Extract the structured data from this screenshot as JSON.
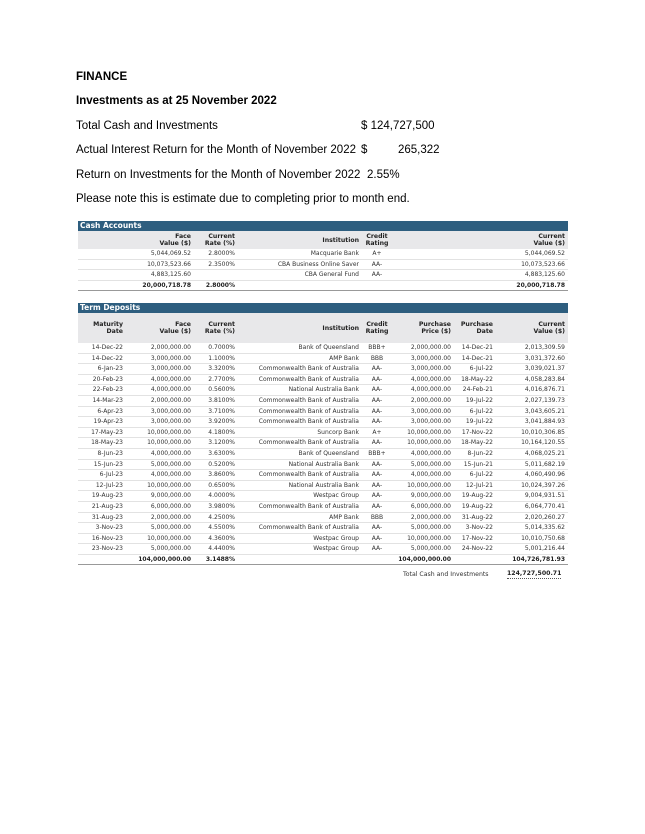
{
  "heading": "FINANCE",
  "subheading": "Investments as at 25 November 2022",
  "summary": [
    {
      "label": "Total Cash and Investments",
      "value": "$ 124,727,500"
    },
    {
      "label": "Actual Interest Return for the Month of November 2022",
      "currency": "$",
      "value": "265,322"
    },
    {
      "label": "Return on Investments for the Month of November 2022",
      "value": "2.55%"
    }
  ],
  "note": "Please note this is estimate due to completing prior to month end.",
  "cash_accounts": {
    "title": "Cash Accounts",
    "headers": {
      "face_value": [
        "Face",
        "Value ($)"
      ],
      "current_rate": [
        "Current",
        "Rate (%)"
      ],
      "institution": "Institution",
      "credit_rating": [
        "Credit",
        "Rating"
      ],
      "current_value": [
        "Current",
        "Value ($)"
      ]
    },
    "rows": [
      {
        "face_value": "5,044,069.52",
        "current_rate": "2.8000%",
        "institution": "Macquarie Bank",
        "credit_rating": "A+",
        "current_value": "5,044,069.52"
      },
      {
        "face_value": "10,073,523.66",
        "current_rate": "2.3500%",
        "institution": "CBA Business Online Saver",
        "credit_rating": "AA-",
        "current_value": "10,073,523.66"
      },
      {
        "face_value": "4,883,125.60",
        "current_rate": "",
        "institution": "CBA General Fund",
        "credit_rating": "AA-",
        "current_value": "4,883,125.60"
      }
    ],
    "total": {
      "face_value": "20,000,718.78",
      "current_rate": "2.8000%",
      "current_value": "20,000,718.78"
    }
  },
  "term_deposits": {
    "title": "Term Deposits",
    "headers": {
      "maturity_date": [
        "Maturity",
        "Date"
      ],
      "face_value": [
        "Face",
        "Value ($)"
      ],
      "current_rate": [
        "Current",
        "Rate (%)"
      ],
      "institution": "Institution",
      "credit_rating": [
        "Credit",
        "Rating"
      ],
      "purchase_price": [
        "Purchase",
        "Price ($)"
      ],
      "purchase_date": [
        "Purchase",
        "Date"
      ],
      "current_value": [
        "Current",
        "Value ($)"
      ]
    },
    "rows": [
      {
        "maturity_date": "14-Dec-22",
        "face_value": "2,000,000.00",
        "current_rate": "0.7000%",
        "institution": "Bank of Queensland",
        "credit_rating": "BBB+",
        "purchase_price": "2,000,000.00",
        "purchase_date": "14-Dec-21",
        "current_value": "2,013,309.59"
      },
      {
        "maturity_date": "14-Dec-22",
        "face_value": "3,000,000.00",
        "current_rate": "1.1000%",
        "institution": "AMP Bank",
        "credit_rating": "BBB",
        "purchase_price": "3,000,000.00",
        "purchase_date": "14-Dec-21",
        "current_value": "3,031,372.60"
      },
      {
        "maturity_date": "6-Jan-23",
        "face_value": "3,000,000.00",
        "current_rate": "3.3200%",
        "institution": "Commonwealth Bank of Australia",
        "credit_rating": "AA-",
        "purchase_price": "3,000,000.00",
        "purchase_date": "6-Jul-22",
        "current_value": "3,039,021.37"
      },
      {
        "maturity_date": "20-Feb-23",
        "face_value": "4,000,000.00",
        "current_rate": "2.7700%",
        "institution": "Commonwealth Bank of Australia",
        "credit_rating": "AA-",
        "purchase_price": "4,000,000.00",
        "purchase_date": "18-May-22",
        "current_value": "4,058,283.84"
      },
      {
        "maturity_date": "22-Feb-23",
        "face_value": "4,000,000.00",
        "current_rate": "0.5600%",
        "institution": "National Australia Bank",
        "credit_rating": "AA-",
        "purchase_price": "4,000,000.00",
        "purchase_date": "24-Feb-21",
        "current_value": "4,016,876.71"
      },
      {
        "maturity_date": "14-Mar-23",
        "face_value": "2,000,000.00",
        "current_rate": "3.8100%",
        "institution": "Commonwealth Bank of Australia",
        "credit_rating": "AA-",
        "purchase_price": "2,000,000.00",
        "purchase_date": "19-Jul-22",
        "current_value": "2,027,139.73"
      },
      {
        "maturity_date": "6-Apr-23",
        "face_value": "3,000,000.00",
        "current_rate": "3.7100%",
        "institution": "Commonwealth Bank of Australia",
        "credit_rating": "AA-",
        "purchase_price": "3,000,000.00",
        "purchase_date": "6-Jul-22",
        "current_value": "3,043,605.21"
      },
      {
        "maturity_date": "19-Apr-23",
        "face_value": "3,000,000.00",
        "current_rate": "3.9200%",
        "institution": "Commonwealth Bank of Australia",
        "credit_rating": "AA-",
        "purchase_price": "3,000,000.00",
        "purchase_date": "19-Jul-22",
        "current_value": "3,041,884.93"
      },
      {
        "maturity_date": "17-May-23",
        "face_value": "10,000,000.00",
        "current_rate": "4.1800%",
        "institution": "Suncorp Bank",
        "credit_rating": "A+",
        "purchase_price": "10,000,000.00",
        "purchase_date": "17-Nov-22",
        "current_value": "10,010,306.85"
      },
      {
        "maturity_date": "18-May-23",
        "face_value": "10,000,000.00",
        "current_rate": "3.1200%",
        "institution": "Commonwealth Bank of Australia",
        "credit_rating": "AA-",
        "purchase_price": "10,000,000.00",
        "purchase_date": "18-May-22",
        "current_value": "10,164,120.55"
      },
      {
        "maturity_date": "8-Jun-23",
        "face_value": "4,000,000.00",
        "current_rate": "3.6300%",
        "institution": "Bank of Queensland",
        "credit_rating": "BBB+",
        "purchase_price": "4,000,000.00",
        "purchase_date": "8-Jun-22",
        "current_value": "4,068,025.21"
      },
      {
        "maturity_date": "15-Jun-23",
        "face_value": "5,000,000.00",
        "current_rate": "0.5200%",
        "institution": "National Australia Bank",
        "credit_rating": "AA-",
        "purchase_price": "5,000,000.00",
        "purchase_date": "15-Jun-21",
        "current_value": "5,011,682.19"
      },
      {
        "maturity_date": "6-Jul-23",
        "face_value": "4,000,000.00",
        "current_rate": "3.8600%",
        "institution": "Commonwealth Bank of Australia",
        "credit_rating": "AA-",
        "purchase_price": "4,000,000.00",
        "purchase_date": "6-Jul-22",
        "current_value": "4,060,490.96"
      },
      {
        "maturity_date": "12-Jul-23",
        "face_value": "10,000,000.00",
        "current_rate": "0.6500%",
        "institution": "National Australia Bank",
        "credit_rating": "AA-",
        "purchase_price": "10,000,000.00",
        "purchase_date": "12-Jul-21",
        "current_value": "10,024,397.26"
      },
      {
        "maturity_date": "19-Aug-23",
        "face_value": "9,000,000.00",
        "current_rate": "4.0000%",
        "institution": "Westpac Group",
        "credit_rating": "AA-",
        "purchase_price": "9,000,000.00",
        "purchase_date": "19-Aug-22",
        "current_value": "9,004,931.51"
      },
      {
        "maturity_date": "21-Aug-23",
        "face_value": "6,000,000.00",
        "current_rate": "3.9800%",
        "institution": "Commonwealth Bank of Australia",
        "credit_rating": "AA-",
        "purchase_price": "6,000,000.00",
        "purchase_date": "19-Aug-22",
        "current_value": "6,064,770.41"
      },
      {
        "maturity_date": "31-Aug-23",
        "face_value": "2,000,000.00",
        "current_rate": "4.2500%",
        "institution": "AMP Bank",
        "credit_rating": "BBB",
        "purchase_price": "2,000,000.00",
        "purchase_date": "31-Aug-22",
        "current_value": "2,020,260.27"
      },
      {
        "maturity_date": "3-Nov-23",
        "face_value": "5,000,000.00",
        "current_rate": "4.5500%",
        "institution": "Commonwealth Bank of Australia",
        "credit_rating": "AA-",
        "purchase_price": "5,000,000.00",
        "purchase_date": "3-Nov-22",
        "current_value": "5,014,335.62"
      },
      {
        "maturity_date": "16-Nov-23",
        "face_value": "10,000,000.00",
        "current_rate": "4.3600%",
        "institution": "Westpac Group",
        "credit_rating": "AA-",
        "purchase_price": "10,000,000.00",
        "purchase_date": "17-Nov-22",
        "current_value": "10,010,750.68"
      },
      {
        "maturity_date": "23-Nov-23",
        "face_value": "5,000,000.00",
        "current_rate": "4.4400%",
        "institution": "Westpac Group",
        "credit_rating": "AA-",
        "purchase_price": "5,000,000.00",
        "purchase_date": "24-Nov-22",
        "current_value": "5,001,216.44"
      }
    ],
    "total": {
      "face_value": "104,000,000.00",
      "current_rate": "3.1488%",
      "purchase_price": "104,000,000.00",
      "current_value": "104,726,781.93"
    }
  },
  "grand_total": {
    "label": "Total Cash and Investments",
    "value": "124,727,500.71"
  }
}
